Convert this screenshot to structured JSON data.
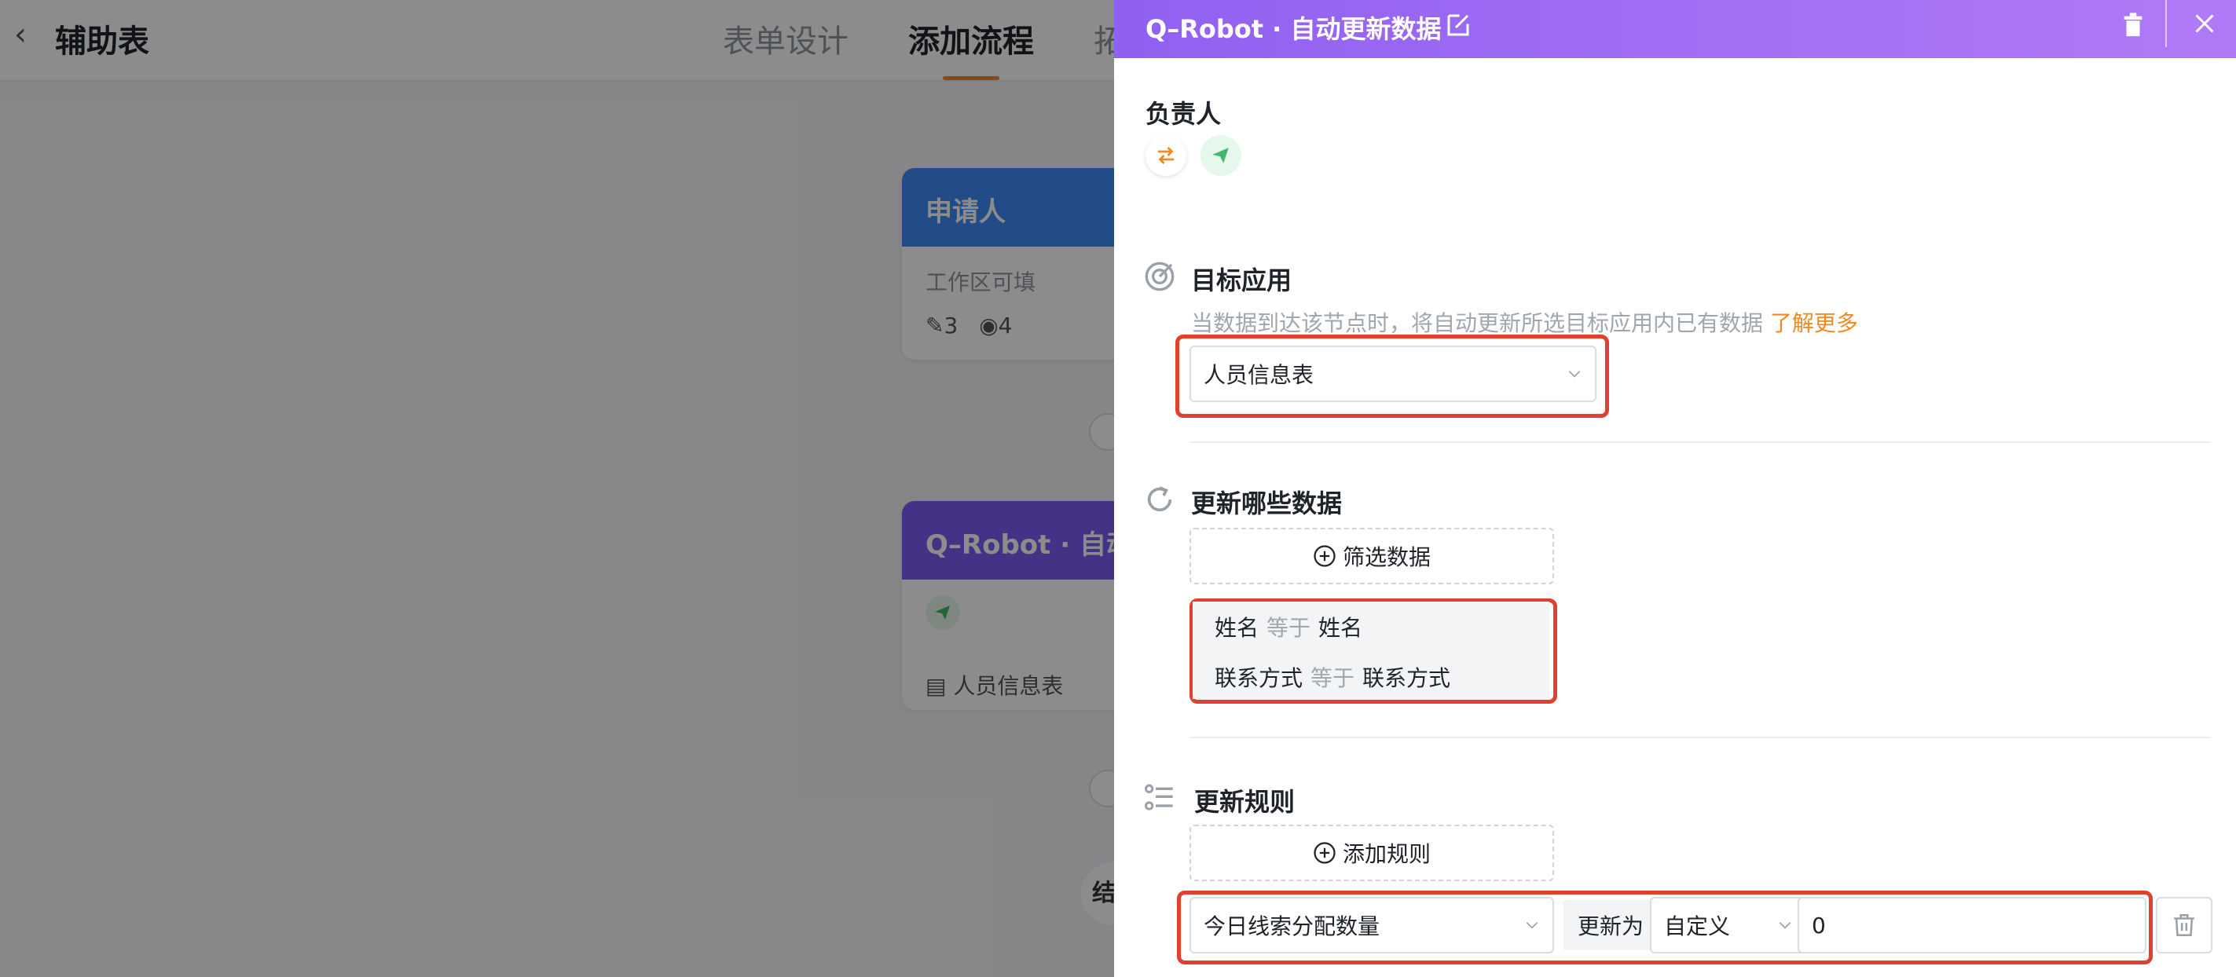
{
  "background": {
    "back_glyph": "‹",
    "app_title": "辅助表",
    "tabs": [
      {
        "label": "表单设计",
        "active": false
      },
      {
        "label": "添加流程",
        "active": true
      },
      {
        "label": "拓",
        "active": false
      }
    ],
    "applicant_node": {
      "title": "申请人",
      "line1": "工作区可填",
      "edit_count": "3",
      "view_count": "4"
    },
    "robot_node": {
      "title": "Q–Robot · 自动",
      "table_name": "人员信息表"
    },
    "end_label": "结"
  },
  "drawer": {
    "title": "Q–Robot · 自动更新数据",
    "owner_section": {
      "label": "负责人"
    },
    "target_section": {
      "label": "目标应用",
      "hint": "当数据到达该节点时，将自动更新所选目标应用内已有数据",
      "hint_link": "了解更多",
      "selected_app": "人员信息表"
    },
    "update_data_section": {
      "label": "更新哪些数据",
      "filter_button": "筛选数据",
      "conditions": [
        {
          "field": "姓名",
          "operator": "等于",
          "value": "姓名"
        },
        {
          "field": "联系方式",
          "operator": "等于",
          "value": "联系方式"
        }
      ]
    },
    "rules_section": {
      "label": "更新规则",
      "add_button": "添加规则",
      "rule": {
        "field": "今日线索分配数量",
        "update_to_label": "更新为",
        "mode": "自定义",
        "value": "0"
      }
    }
  },
  "colors": {
    "accent_orange": "#f08a24",
    "highlight_red": "#e0412e",
    "drawer_header_start": "#9060f0",
    "drawer_header_end": "#b07af7",
    "applicant_blue": "#3d8af7",
    "robot_purple": "#7b5cf2",
    "send_green": "#3fb96b"
  },
  "icons": [
    "chevron-left-icon",
    "edit-icon",
    "trash-icon",
    "close-icon",
    "switch-icon",
    "send-icon",
    "target-icon",
    "refresh-icon",
    "list-icon",
    "plus-circle-icon",
    "chevron-down-icon",
    "pencil-icon",
    "eye-icon",
    "table-icon"
  ]
}
